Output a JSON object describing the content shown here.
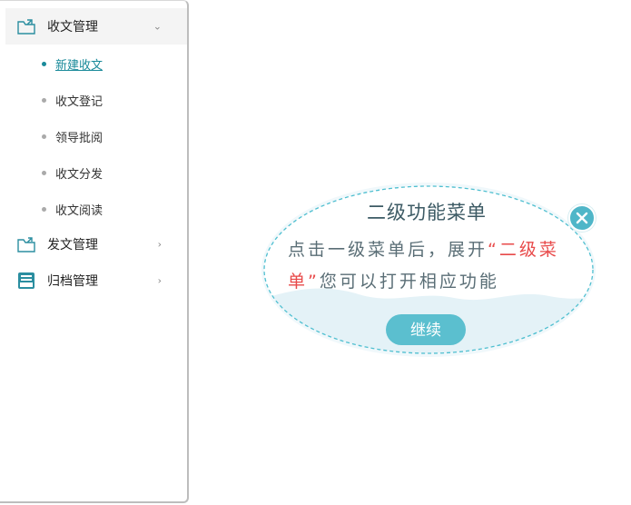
{
  "sidebar": {
    "items": [
      {
        "label": "收文管理",
        "expanded": true,
        "icon": "folder-inbox-icon"
      },
      {
        "label": "发文管理",
        "expanded": false,
        "icon": "folder-outbox-icon"
      },
      {
        "label": "归档管理",
        "expanded": false,
        "icon": "archive-drawer-icon"
      }
    ],
    "subitems": [
      {
        "label": "新建收文",
        "active": true
      },
      {
        "label": "收文登记",
        "active": false
      },
      {
        "label": "领导批阅",
        "active": false
      },
      {
        "label": "收文分发",
        "active": false
      },
      {
        "label": "收文阅读",
        "active": false
      }
    ]
  },
  "tooltip": {
    "title": "二级功能菜单",
    "text_part1": "点击一级菜单后，展开",
    "text_highlight": "“二级菜单”",
    "text_part2": "您可以打开相应功能",
    "button_label": "继续",
    "colors": {
      "accent": "#5bbfcf",
      "highlight": "#e84a4a",
      "bubble_fill": "#e6f4f8",
      "dash": "#4fbfd0"
    }
  },
  "colors": {
    "active_sub": "#1a8a9a",
    "sidebar_border": "#bdbdbd"
  }
}
